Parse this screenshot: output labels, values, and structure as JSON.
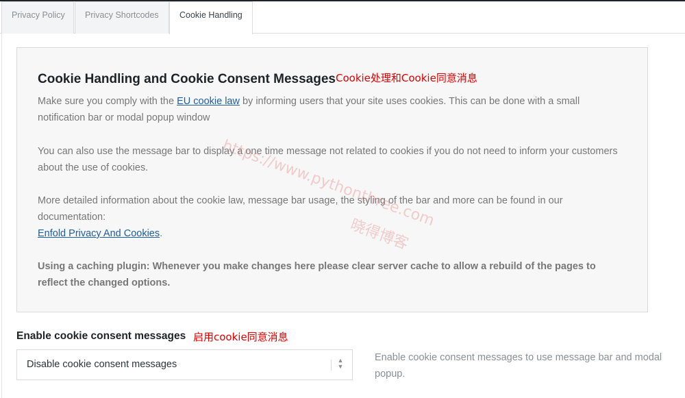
{
  "tabs": [
    {
      "label": "Privacy Policy",
      "active": false
    },
    {
      "label": "Privacy Shortcodes",
      "active": false
    },
    {
      "label": "Cookie Handling",
      "active": true
    }
  ],
  "info": {
    "title": "Cookie Handling and Cookie Consent Messages",
    "title_annotation": "Cookie处理和Cookie同意消息",
    "p1_before": "Make sure you comply with the ",
    "p1_link": "EU cookie law",
    "p1_after": " by informing users that your site uses cookies. This can be done with a small notification bar or modal popup window",
    "p2": "You can also use the message bar to display a one time message not related to cookies if you do not need to inform your customers about the use of cookies.",
    "p3_text": "More detailed information about the cookie law, message bar usage, the styling of the bar and more can be found in our documentation:",
    "p3_link": "Enfold Privacy And Cookies",
    "p3_after": ".",
    "p4": "Using a caching plugin: Whenever you make changes here please clear server cache to allow a rebuild of the pages to reflect the changed options."
  },
  "watermark": {
    "line1": "https://www.pythonthree.com",
    "line2": "晓得博客"
  },
  "option": {
    "label": "Enable cookie consent messages",
    "label_annotation": "启用cookie同意消息",
    "selected": "Disable cookie consent messages",
    "description": "Enable cookie consent messages to use message bar and modal popup."
  },
  "colors": {
    "link": "#1e5d9b",
    "annotation": "#e00000",
    "info_bg": "#f7f7f7"
  }
}
